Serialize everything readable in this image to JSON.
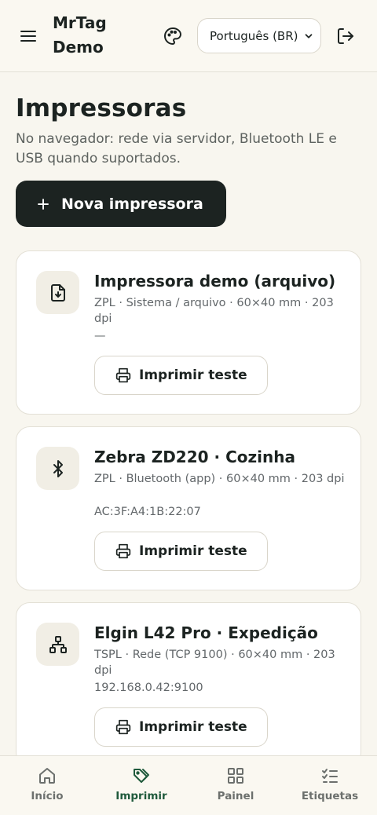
{
  "header": {
    "brand": "MrTag Demo",
    "language": "Português (BR)",
    "icons": {
      "menu": "menu-icon",
      "theme": "palette-icon",
      "logout": "logout-icon"
    }
  },
  "main": {
    "title": "Impressoras",
    "subtitle": "No navegador: rede via servidor, Bluetooth LE e USB quando suportados.",
    "new_button": "Nova impressora"
  },
  "printers": [
    {
      "name": "Impressora demo (arquivo)",
      "meta": "ZPL · Sistema / arquivo · 60×40 mm · 203 dpi",
      "detail": "—",
      "icon": "file-download-icon",
      "action": "Imprimir teste"
    },
    {
      "name": "Zebra ZD220 · Cozinha",
      "meta": "ZPL · Bluetooth (app) · 60×40 mm · 203 dpi",
      "detail": "AC:3F:A4:1B:22:07",
      "icon": "bluetooth-icon",
      "action": "Imprimir teste"
    },
    {
      "name": "Elgin L42 Pro · Expedição",
      "meta": "TSPL · Rede (TCP 9100) · 60×40 mm · 203 dpi",
      "detail": "192.168.0.42:9100",
      "icon": "network-icon",
      "action": "Imprimir teste"
    }
  ],
  "nav": [
    {
      "label": "Início",
      "icon": "home-icon",
      "active": false
    },
    {
      "label": "Imprimir",
      "icon": "tag-icon",
      "active": true
    },
    {
      "label": "Painel",
      "icon": "grid-icon",
      "active": false
    },
    {
      "label": "Etiquetas",
      "icon": "checklist-icon",
      "active": false
    }
  ],
  "colors": {
    "accent": "#1f5a3c",
    "primary_button": "#1c2321",
    "background": "#f8f6ef"
  }
}
